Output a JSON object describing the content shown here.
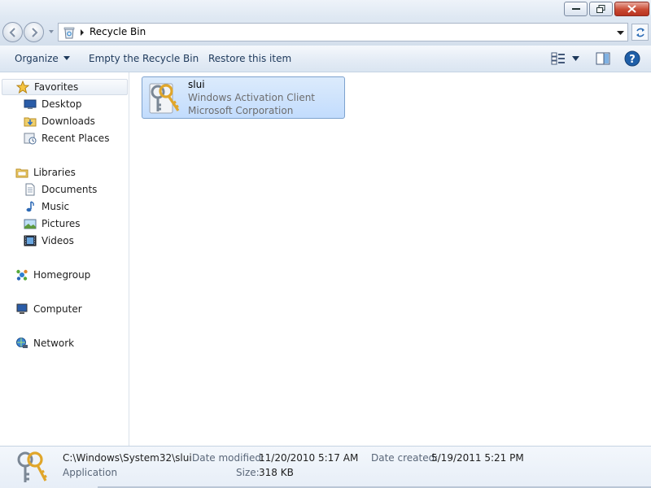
{
  "address": {
    "location": "Recycle Bin"
  },
  "toolbar": {
    "organize_label": "Organize",
    "empty_label": "Empty the Recycle Bin",
    "restore_label": "Restore this item"
  },
  "nav": {
    "favorites": {
      "label": "Favorites",
      "icon": "star-icon",
      "items": [
        {
          "label": "Desktop",
          "icon": "desktop-icon"
        },
        {
          "label": "Downloads",
          "icon": "downloads-folder-icon"
        },
        {
          "label": "Recent Places",
          "icon": "recent-places-icon"
        }
      ]
    },
    "libraries": {
      "label": "Libraries",
      "icon": "libraries-icon",
      "items": [
        {
          "label": "Documents",
          "icon": "documents-icon"
        },
        {
          "label": "Music",
          "icon": "music-icon"
        },
        {
          "label": "Pictures",
          "icon": "pictures-icon"
        },
        {
          "label": "Videos",
          "icon": "videos-icon"
        }
      ]
    },
    "homegroup": {
      "label": "Homegroup",
      "icon": "homegroup-icon"
    },
    "computer": {
      "label": "Computer",
      "icon": "computer-icon"
    },
    "network": {
      "label": "Network",
      "icon": "network-icon"
    }
  },
  "files": [
    {
      "name": "slui",
      "description": "Windows Activation Client",
      "company": "Microsoft Corporation",
      "icon": "keys-icon",
      "selected": true
    }
  ],
  "details": {
    "original_location": "C:\\Windows\\System32\\slui",
    "type": "Application",
    "date_modified_label": "Date modified:",
    "date_modified": "11/20/2010 5:17 AM",
    "size_label": "Size:",
    "size": "318 KB",
    "date_created_label": "Date created:",
    "date_created": "5/19/2011 5:21 PM"
  },
  "colors": {
    "selection": "#c2dcfd",
    "command_text": "#1e395b",
    "close_button": "#c94a33"
  }
}
